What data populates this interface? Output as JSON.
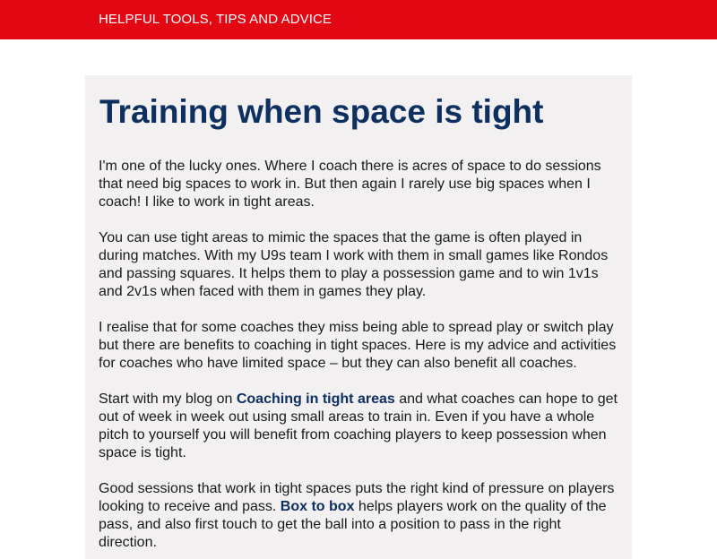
{
  "header": {
    "tagline": "HELPFUL TOOLS, TIPS AND ADVICE"
  },
  "article": {
    "title": "Training when space is tight",
    "p1": [
      "I'm one of the lucky ones. Where I coach there is acres of space to do sessions",
      "that need big spaces to work in. But then again I rarely use big spaces when I",
      "coach! I like to work in tight areas."
    ],
    "p2": [
      "You can use tight areas to mimic the spaces that the game is often played in",
      "during matches. With my U9s team I work with them in small games like Rondos",
      "and passing squares. It helps them to play a possession game and to win 1v1s",
      "and 2v1s when faced with them in games they play."
    ],
    "p3": [
      "I realise that for some coaches they miss being able to spread play or switch play",
      "but there are benefits to coaching in tight spaces. Here is my advice and activities",
      "for coaches who have limited space – but they can also benefit all coaches."
    ],
    "p4": {
      "l1_before": "Start with my blog on ",
      "l1_link": "Coaching in tight areas",
      "l1_after": " and what coaches can hope to get",
      "l2": "out of week in week out using small areas to train in. Even if you have a whole",
      "l3": "pitch to yourself you will benefit from coaching players to keep possession when",
      "l4": "space is tight."
    },
    "p5": {
      "l1": "Good sessions that work in tight spaces puts the right kind of pressure on players",
      "l2_before": "looking to receive and pass. ",
      "l2_link": "Box to box",
      "l2_after": " helps players work on the quality of the",
      "l3": "pass, and also first touch to get the ball into a position to pass in the right",
      "l4": "direction."
    }
  }
}
